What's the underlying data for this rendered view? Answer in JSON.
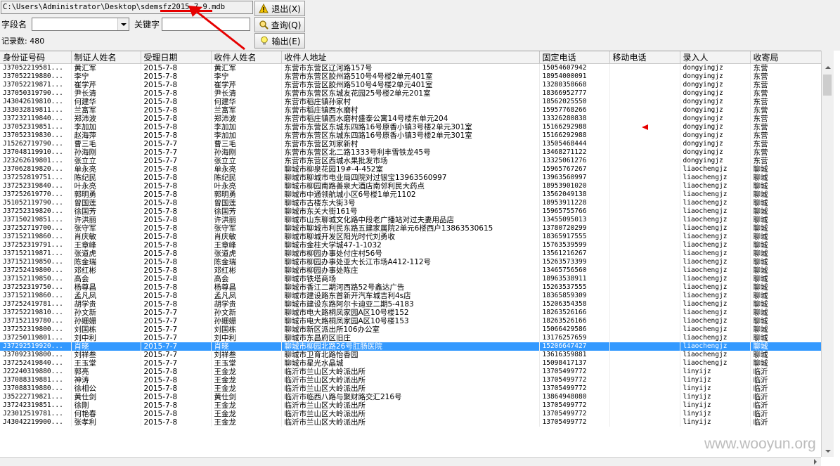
{
  "toolbar": {
    "path": "C:\\Users\\Administrator\\Desktop\\sdemsfz2015-7-9.mdb",
    "field_label": "字段名",
    "keyword_label": "关键字",
    "record_count": "记录数: 480",
    "exit_label": "退出(X)",
    "query_label": "查询(Q)",
    "export_label": "输出(E)"
  },
  "table": {
    "columns": [
      "身份证号码",
      "制证人姓名",
      "受理日期",
      "收件人姓名",
      "收件人地址",
      "固定电话",
      "移动电话",
      "录入人",
      "收寄局"
    ],
    "selected_row": 33,
    "rows": [
      [
        "J37052219581...",
        "黄汇军",
        "2015-7-8",
        "黄汇军",
        "东营市东营区辽河路157号",
        "15054607942",
        "",
        "dongyingjz",
        "东营"
      ],
      [
        "J37052219880...",
        "李宁",
        "2015-7-8",
        "李宁",
        "东营市东营区胶州路510号4号楼2单元401室",
        "18954000091",
        "",
        "dongyingjz",
        "东营"
      ],
      [
        "J37052219871...",
        "崔学芹",
        "2015-7-8",
        "崔学芹",
        "东营市东营区胶州路510号4号楼2单元401室",
        "13280358668",
        "",
        "dongyingjz",
        "东营"
      ],
      [
        "J37050319790...",
        "尹长清",
        "2015-7-8",
        "尹长清",
        "东营市东营区东城友花园25号楼2单元201室",
        "18366952777",
        "",
        "dongyingjz",
        "东营"
      ],
      [
        "J43042619810...",
        "何建华",
        "2015-7-8",
        "何建华",
        "东营市稻庄镇孙家村",
        "18562025550",
        "",
        "dongyingjz",
        "东营"
      ],
      [
        "J33032819811...",
        "兰富军",
        "2015-7-8",
        "兰富军",
        "东营市稻庄镇西水磨村",
        "15957768266",
        "",
        "dongyingjz",
        "东营"
      ],
      [
        "J37232119840...",
        "郑沛波",
        "2015-7-8",
        "郑沛波",
        "东营市稻庄镇西水磨村盛泰公寓14号楼东单元204",
        "13326280838",
        "",
        "dongyingjz",
        "东营"
      ],
      [
        "J37052319851...",
        "李加加",
        "2015-7-8",
        "李加加",
        "东营市东营区东城东四路16号原香小镇3号楼2单元301室",
        "15166292988",
        "",
        "dongyingjz",
        "东营"
      ],
      [
        "J37052319830...",
        "赵海萍",
        "2015-7-8",
        "李加加",
        "东营市东营区东城东四路16号原香小镇3号楼2单元301室",
        "15166292988",
        "",
        "dongyingjz",
        "东营"
      ],
      [
        "J15262719790...",
        "曹三毛",
        "2015-7-7",
        "曹三毛",
        "东营市东营区刘家新村",
        "13505468444",
        "",
        "dongyingjz",
        "东营"
      ],
      [
        "J37048119910...",
        "孙海刚",
        "2015-7-7",
        "孙海刚",
        "东营市东营区北二路1333号利丰雪铁龙45号",
        "13468271122",
        "",
        "dongyingjz",
        "东营"
      ],
      [
        "J23262619801...",
        "张立立",
        "2015-7-7",
        "张立立",
        "东营市东营区西城水果批发市场",
        "13325061276",
        "",
        "dongyingjz",
        "东营"
      ],
      [
        "J37062819820...",
        "单永亮",
        "2015-7-8",
        "单永亮",
        "聊城市柳泉花园19#-4-452室",
        "15965767267",
        "",
        "liaochengjz",
        "聊城"
      ],
      [
        "J37252819751...",
        "陈纪民",
        "2015-7-8",
        "陈纪民",
        "聊城市聊城市电业局四院对过银宝13963560997",
        "13963560997",
        "",
        "liaochengjz",
        "聊城"
      ],
      [
        "J37252319840...",
        "叶永亮",
        "2015-7-8",
        "叶永亮",
        "聊城市柳园南路善泉大酒店南邻利民大药点",
        "18953901020",
        "",
        "liaochengjz",
        "聊城"
      ],
      [
        "J37252619770...",
        "郭明勇",
        "2015-7-8",
        "郭明勇",
        "聊城市中通领航城小区6号楼1单元1102",
        "13562049138",
        "",
        "liaochengjz",
        "聊城"
      ],
      [
        "J51052119790...",
        "曾国莲",
        "2015-7-8",
        "曾国莲",
        "聊城市古楼东大街3号",
        "18953911228",
        "",
        "liaochengjz",
        "聊城"
      ],
      [
        "J37252319820...",
        "徐国芳",
        "2015-7-8",
        "徐国芳",
        "聊城市东关大街161号",
        "15965755766",
        "",
        "liaochengjz",
        "聊城"
      ],
      [
        "J37150219851...",
        "许洪丽",
        "2015-7-8",
        "许洪丽",
        "聊城市山东聊城文化路中段老广播站对过夫妻用品店",
        "13455095013",
        "",
        "liaochengjz",
        "聊城"
      ],
      [
        "J37252719700...",
        "张守军",
        "2015-7-8",
        "张守军",
        "聊城市聊城市利民东路五建家属院2单元6楼西户13863530615",
        "13780720299",
        "",
        "liaochengjz",
        "聊城"
      ],
      [
        "J37152119860...",
        "肖庆敏",
        "2015-7-8",
        "肖庆敏",
        "聊城市聊城开发区阳光时代刘勇收",
        "18365917555",
        "",
        "liaochengjz",
        "聊城"
      ],
      [
        "J37252319791...",
        "王章峰",
        "2015-7-8",
        "王章峰",
        "聊城市金柱大学城47-1-1032",
        "15763539599",
        "",
        "liaochengjz",
        "聊城"
      ],
      [
        "J37152119871...",
        "张道虎",
        "2015-7-8",
        "张道虎",
        "聊城市柳园办事处付庄村56号",
        "13561216267",
        "",
        "liaochengjz",
        "聊城"
      ],
      [
        "J37152119850...",
        "陈金瑞",
        "2015-7-8",
        "陈金瑞",
        "聊城市柳园办事处亚大长江市场A412-112号",
        "15263573399",
        "",
        "liaochengjz",
        "聊城"
      ],
      [
        "J37252419800...",
        "邓红彬",
        "2015-7-8",
        "邓红彬",
        "聊城市柳园办事处陈庄",
        "13465756560",
        "",
        "liaochengjz",
        "聊城"
      ],
      [
        "J37152119850...",
        "高会",
        "2015-7-8",
        "高会",
        "聊城市铁塔商场",
        "18963538911",
        "",
        "liaochengjz",
        "聊城"
      ],
      [
        "J37252319750...",
        "杨尊昌",
        "2015-7-8",
        "杨尊昌",
        "聊城市香江二期河西路52号鑫达广告",
        "15263537555",
        "",
        "liaochengjz",
        "聊城"
      ],
      [
        "J37152119860...",
        "孟凡凤",
        "2015-7-8",
        "孟凡凤",
        "聊城市建设路东首新开汽车城吉利4s店",
        "18365859309",
        "",
        "liaochengjz",
        "聊城"
      ],
      [
        "J37252419781...",
        "胡学贵",
        "2015-7-8",
        "胡学贵",
        "聊城市建设东路阿尔卡迪亚二期5-4183",
        "15206354358",
        "",
        "liaochengjz",
        "聊城"
      ],
      [
        "J37252219810...",
        "孙文新",
        "2015-7-7",
        "孙文新",
        "聊城市电大路桐凤家园A区10号楼152",
        "18263526166",
        "",
        "liaochengjz",
        "聊城"
      ],
      [
        "J37152119780...",
        "孙姗姗",
        "2015-7-7",
        "孙姗姗",
        "聊城市电大路桐凤家园A区10号楼153",
        "18263526166",
        "",
        "liaochengjz",
        "聊城"
      ],
      [
        "J37252319800...",
        "刘国栋",
        "2015-7-7",
        "刘国栋",
        "聊城市新区派出所106办公室",
        "15066429586",
        "",
        "liaochengjz",
        "聊城"
      ],
      [
        "J37250119801...",
        "刘中利",
        "2015-7-7",
        "刘中利",
        "聊城市东昌府区旧庄",
        "13176257659",
        "",
        "liaochengjz",
        "聊城"
      ],
      [
        "J37292519920...",
        "肖晓",
        "2015-7-7",
        "肖晓",
        "聊城市柳园北路26号肛肠医院",
        "15206647427",
        "",
        "liaochengjz",
        "聊城"
      ],
      [
        "J37092319800...",
        "刘祥叁",
        "2015-7-7",
        "刘祥叁",
        "聊城市卫育北路怡香园",
        "13616359881",
        "",
        "liaochengjz",
        "聊城"
      ],
      [
        "J37252419840...",
        "王玉堂",
        "2015-7-7",
        "王玉堂",
        "聊城市星光水晶城",
        "15098417137",
        "",
        "liaochengjz",
        "聊城"
      ],
      [
        "J22240319880...",
        "郭亮",
        "2015-7-8",
        "王金龙",
        "临沂市兰山区大岭派出所",
        "13705499772",
        "",
        "linyijz",
        "临沂"
      ],
      [
        "J37088319881...",
        "神涛",
        "2015-7-8",
        "王金龙",
        "临沂市兰山区大岭派出所",
        "13705499772",
        "",
        "linyijz",
        "临沂"
      ],
      [
        "J37088319880...",
        "徐相公",
        "2015-7-8",
        "王金龙",
        "临沂市兰山区大岭派出所",
        "13705499772",
        "",
        "linyijz",
        "临沂"
      ],
      [
        "J35222719821...",
        "黄仕剑",
        "2015-7-8",
        "黄仕剑",
        "临沂市临西八路与聚财路交汇216号",
        "13864948080",
        "",
        "linyijz",
        "临沂"
      ],
      [
        "J37242319851...",
        "徐刚",
        "2015-7-8",
        "王金龙",
        "临沂市兰山区大岭派出所",
        "13705499772",
        "",
        "linyijz",
        "临沂"
      ],
      [
        "J23012519781...",
        "何艳春",
        "2015-7-8",
        "王金龙",
        "临沂市兰山区大岭派出所",
        "13705499772",
        "",
        "linyijz",
        "临沂"
      ],
      [
        "J43042219900...",
        "张孝利",
        "2015-7-8",
        "王金龙",
        "临沂市兰山区大岭派出所",
        "13705499772",
        "",
        "linyijz",
        "临沂"
      ]
    ]
  },
  "watermark": "www.wooyun.org",
  "colors": {
    "selection": "#3399ff",
    "annotation": "#e60000"
  },
  "icons": {
    "exit": "warning-icon",
    "query": "search-icon",
    "export": "lightbulb-icon"
  }
}
